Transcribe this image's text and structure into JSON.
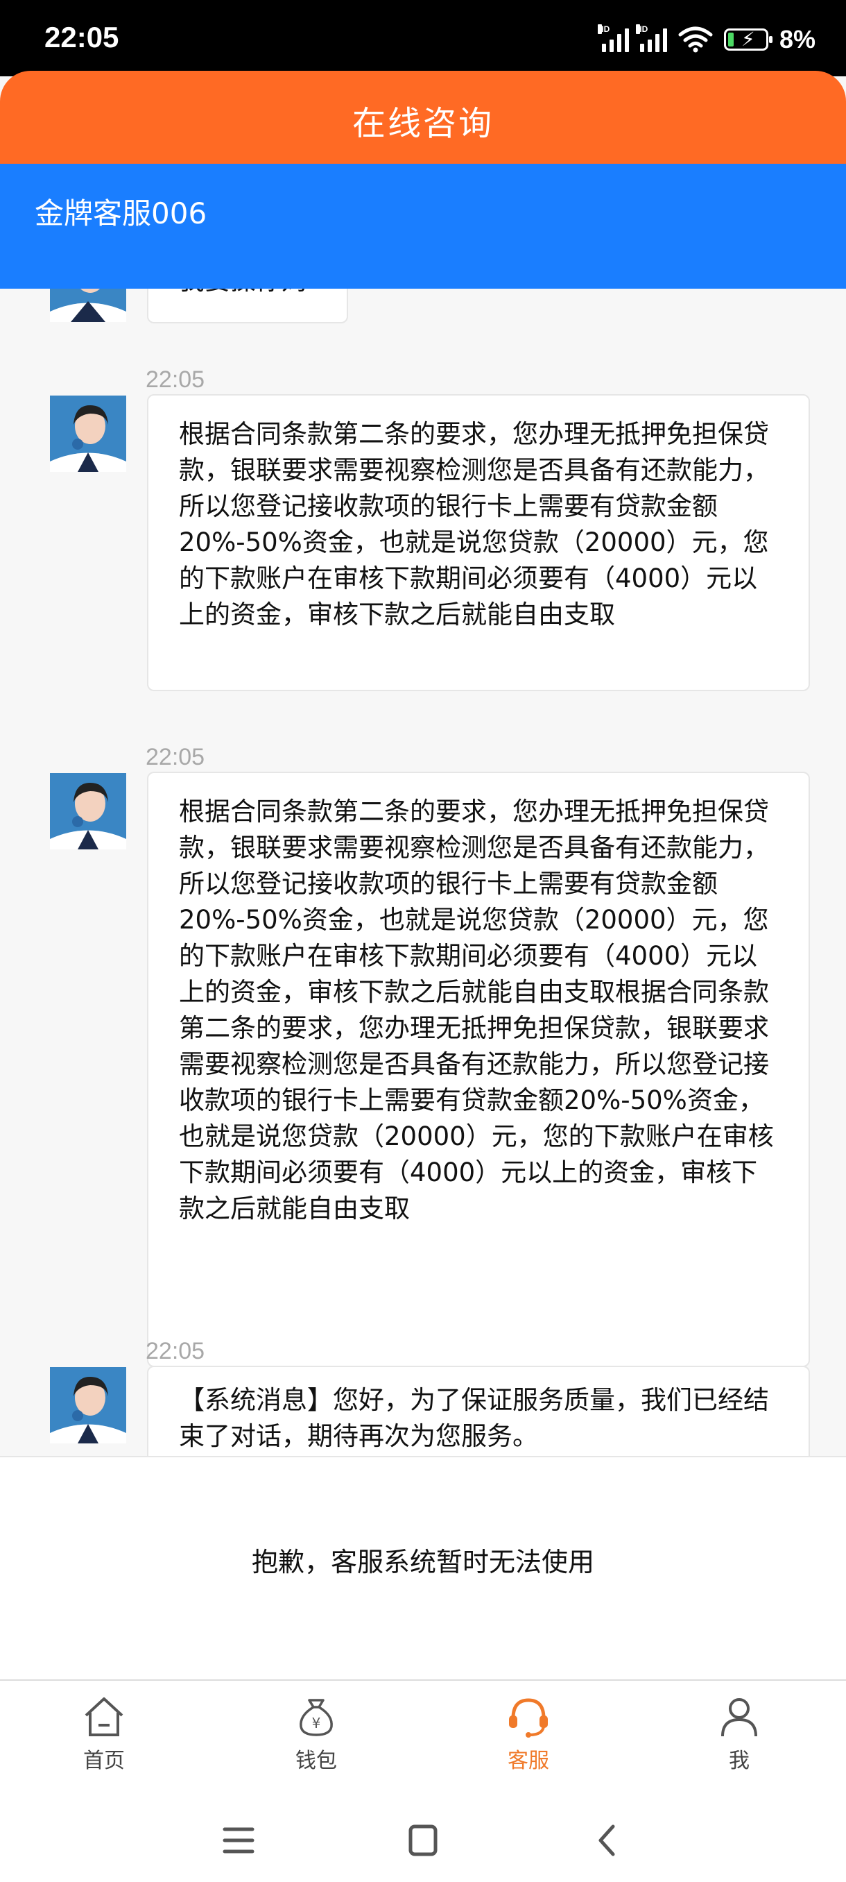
{
  "status_bar": {
    "time": "22:05",
    "battery": "8%",
    "signal1_label": "HD",
    "signal2_label": "HD"
  },
  "header": {
    "title": "在线咨询"
  },
  "agent": {
    "name": "金牌客服006"
  },
  "messages": [
    {
      "partial_text": "我要操你妈"
    },
    {
      "time": "22:05",
      "text": "根据合同条款第二条的要求，您办理无抵押免担保贷款，银联要求需要视察检测您是否具备有还款能力，所以您登记接收款项的银行卡上需要有贷款金额20%-50%资金，也就是说您贷款（20000）元，您的下款账户在审核下款期间必须要有（4000）元以上的资金，审核下款之后就能自由支取"
    },
    {
      "time": "22:05",
      "text": "根据合同条款第二条的要求，您办理无抵押免担保贷款，银联要求需要视察检测您是否具备有还款能力，所以您登记接收款项的银行卡上需要有贷款金额20%-50%资金，也就是说您贷款（20000）元，您的下款账户在审核下款期间必须要有（4000）元以上的资金，审核下款之后就能自由支取根据合同条款第二条的要求，您办理无抵押免担保贷款，银联要求需要视察检测您是否具备有还款能力，所以您登记接收款项的银行卡上需要有贷款金额20%-50%资金，也就是说您贷款（20000）元，您的下款账户在审核下款期间必须要有（4000）元以上的资金，审核下款之后就能自由支取"
    },
    {
      "time": "22:05",
      "text": "【系统消息】您好，为了保证服务质量，我们已经结束了对话，期待再次为您服务。"
    }
  ],
  "notice": {
    "text": "抱歉，客服系统暂时无法使用"
  },
  "tabs": [
    {
      "label": "首页",
      "icon": "home-icon"
    },
    {
      "label": "钱包",
      "icon": "wallet-icon"
    },
    {
      "label": "客服",
      "icon": "headset-icon",
      "active": true
    },
    {
      "label": "我",
      "icon": "user-icon"
    }
  ],
  "colors": {
    "header": "#ff6a24",
    "agent_bar": "#1a7eff",
    "active_tab": "#f07a2a"
  }
}
